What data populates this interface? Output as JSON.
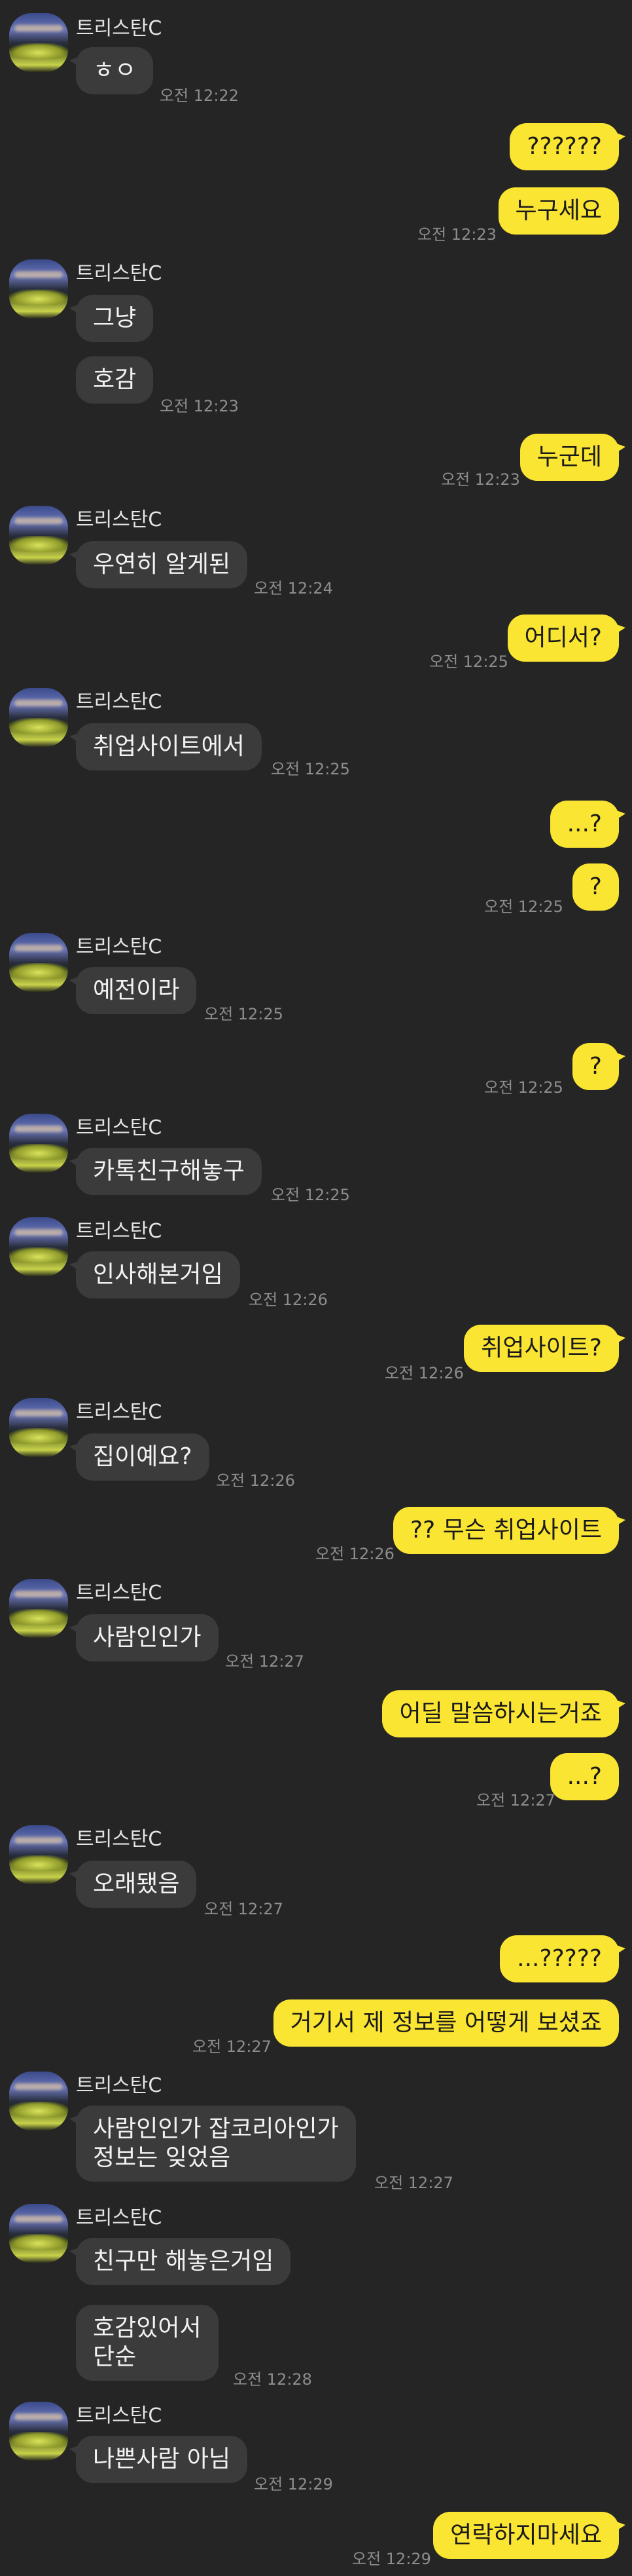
{
  "sender_name": "트리스탄C",
  "messages": [
    {
      "text": "ㅎㅇ",
      "time": "오전 12:22"
    },
    {
      "text": "??????"
    },
    {
      "text": "누구세요",
      "time": "오전 12:23"
    },
    {
      "text": "그냥"
    },
    {
      "text": "호감",
      "time": "오전 12:23"
    },
    {
      "text": "누군데",
      "time": "오전 12:23"
    },
    {
      "text": "우연히 알게된",
      "time": "오전 12:24"
    },
    {
      "text": "어디서?",
      "time": "오전 12:25"
    },
    {
      "text": "취업사이트에서",
      "time": "오전 12:25"
    },
    {
      "text": "...?"
    },
    {
      "text": "?",
      "time": "오전 12:25"
    },
    {
      "text": "예전이라",
      "time": "오전 12:25"
    },
    {
      "text": "?",
      "time": "오전 12:25"
    },
    {
      "text": "카톡친구해놓구",
      "time": "오전 12:25"
    },
    {
      "text": "인사해본거임",
      "time": "오전 12:26"
    },
    {
      "text": "취업사이트?",
      "time": "오전 12:26"
    },
    {
      "text": "집이예요?",
      "time": "오전 12:26"
    },
    {
      "text": "?? 무슨 취업사이트",
      "time": "오전 12:26"
    },
    {
      "text": "사람인인가",
      "time": "오전 12:27"
    },
    {
      "text": "어딜 말씀하시는거죠"
    },
    {
      "text": "...?",
      "time": "오전 12:27"
    },
    {
      "text": "오래됐음",
      "time": "오전 12:27"
    },
    {
      "text": "...?????"
    },
    {
      "text": "거기서 제 정보를 어떻게 보셨죠",
      "time": "오전 12:27"
    },
    {
      "text": "사람인인가 잡코리아인가\n정보는 잊었음",
      "time": "오전 12:27"
    },
    {
      "text": "친구만 해놓은거임"
    },
    {
      "text": "호감있어서\n단순",
      "time": "오전 12:28"
    },
    {
      "text": "나쁜사람 아님",
      "time": "오전 12:29"
    },
    {
      "text": "연락하지마세요",
      "time": "오전 12:29"
    }
  ]
}
